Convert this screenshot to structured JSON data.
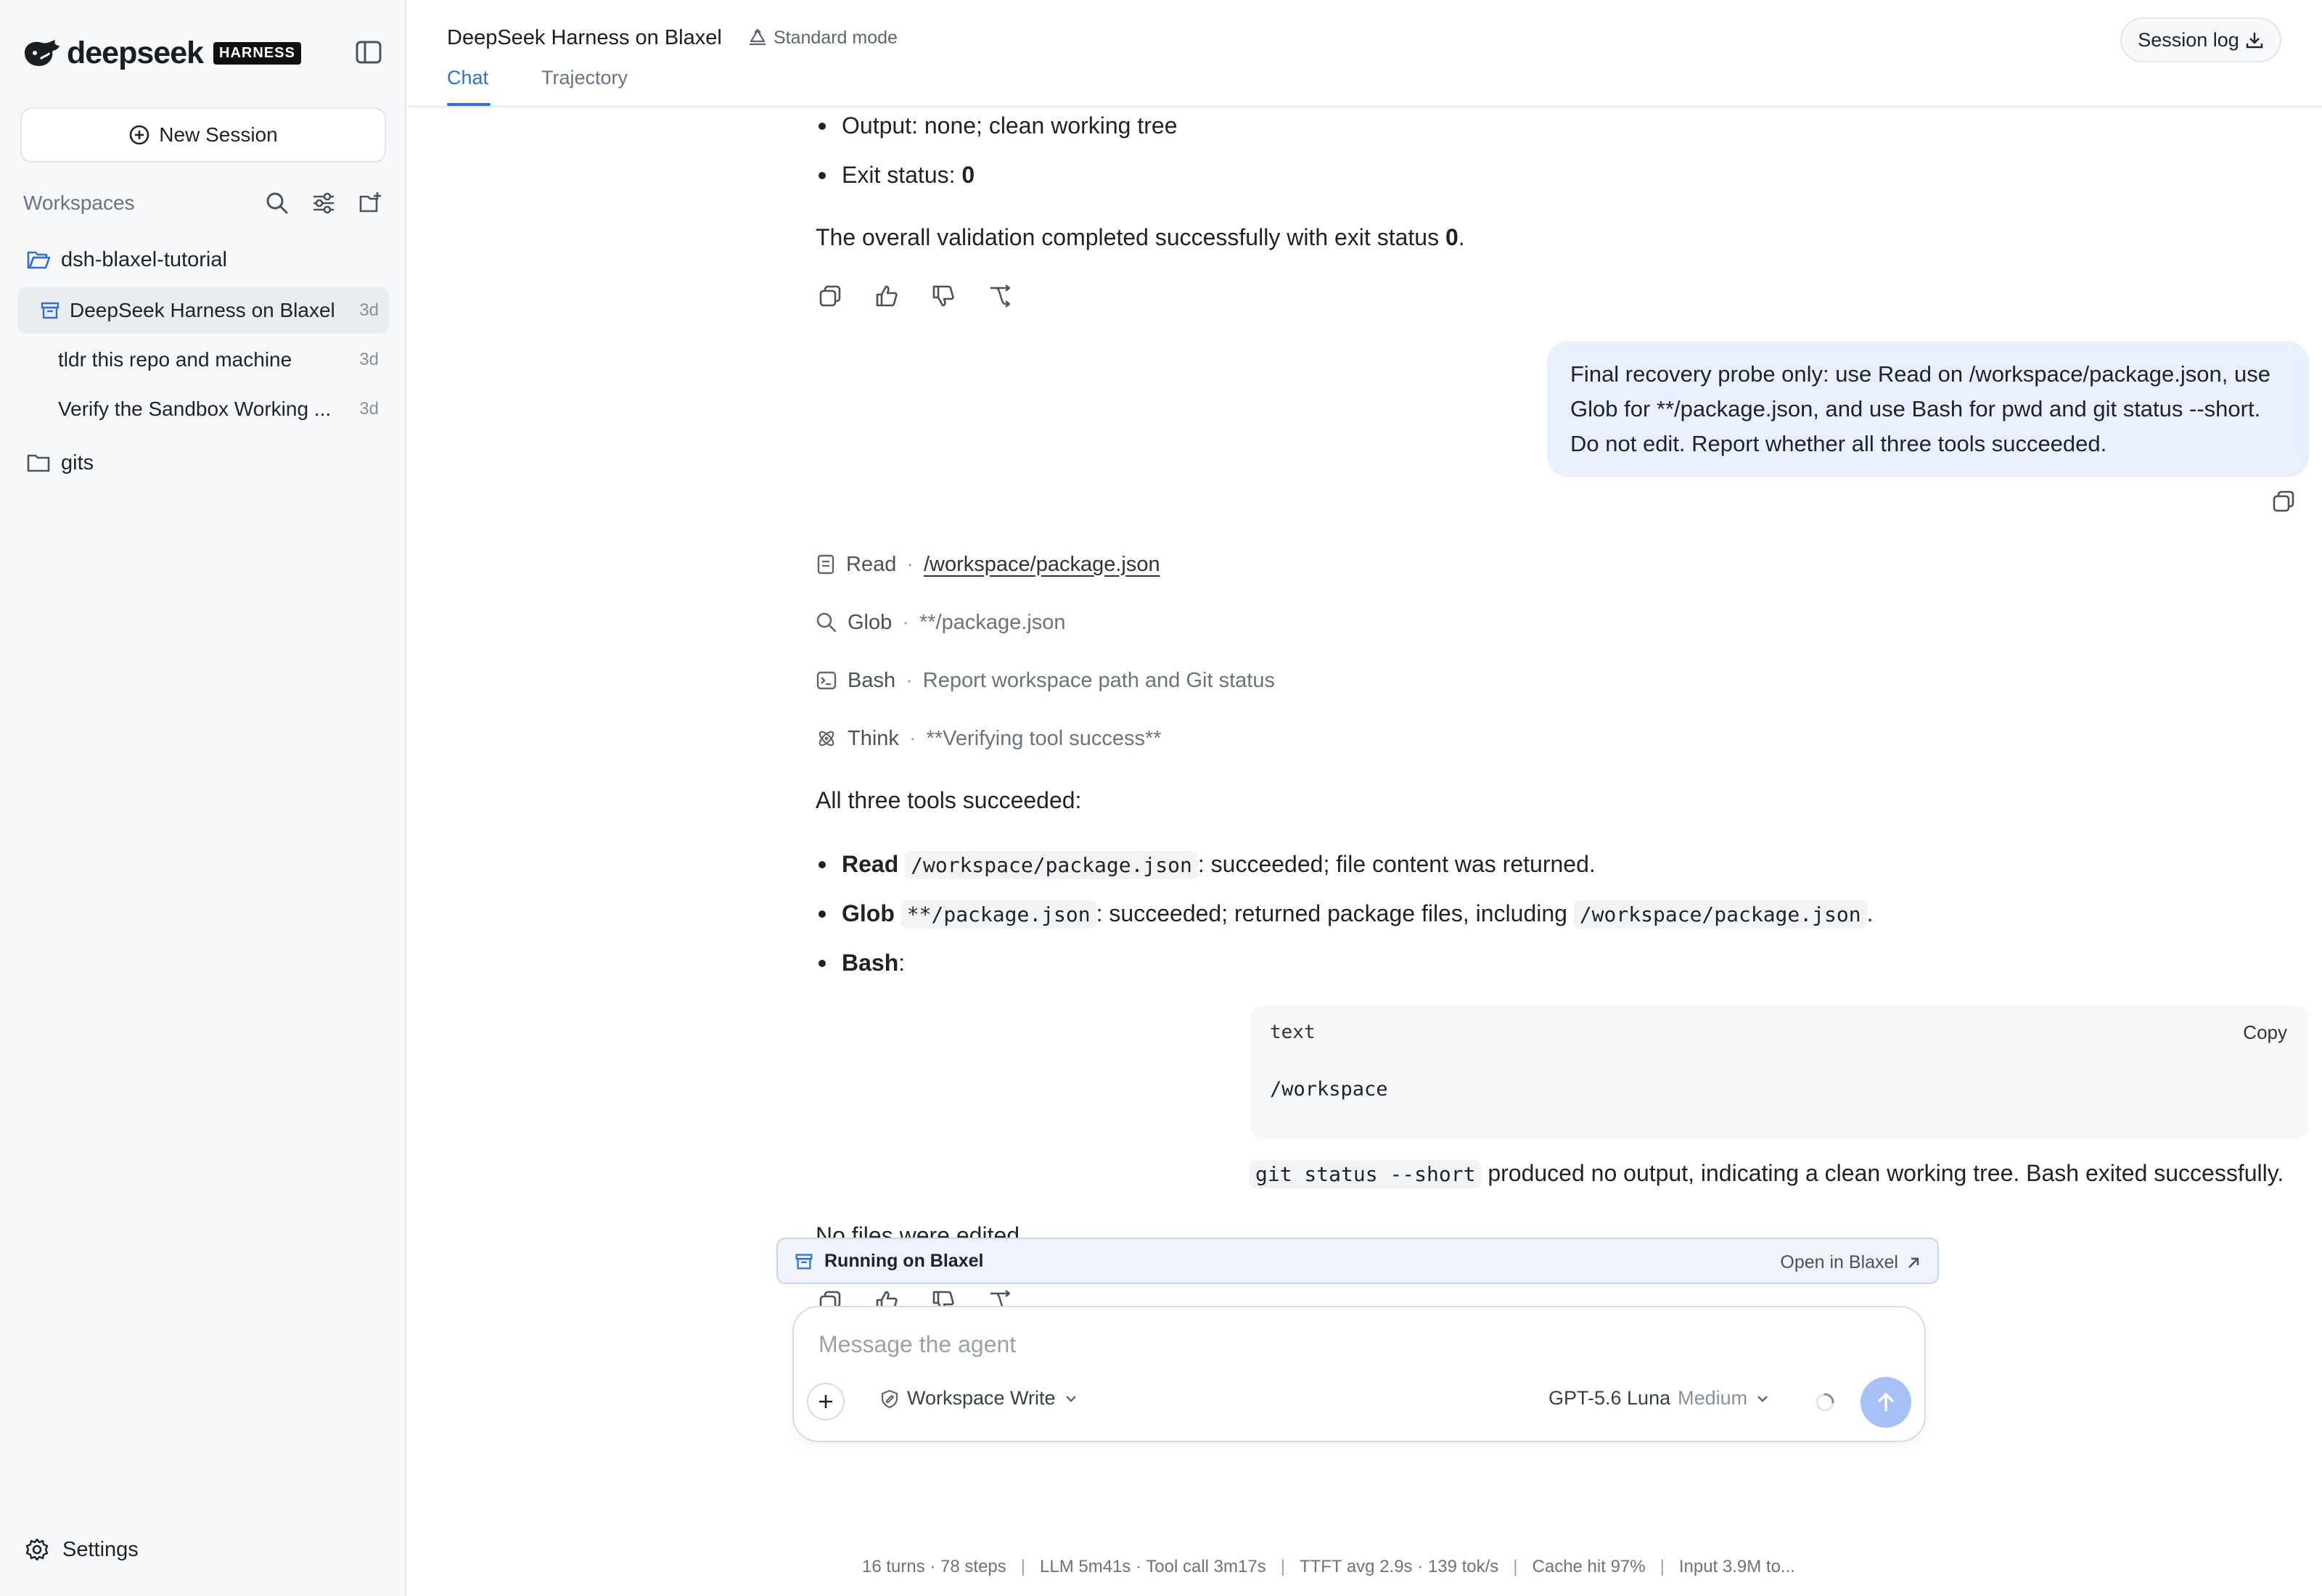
{
  "brand": {
    "name": "deepseek",
    "badge": "HARNESS"
  },
  "sidebar": {
    "new_session": "New Session",
    "workspaces_title": "Workspaces",
    "workspace_name": "dsh-blaxel-tutorial",
    "sessions": [
      {
        "label": "DeepSeek Harness on Blaxel",
        "age": "3d"
      },
      {
        "label": "tldr this repo and machine",
        "age": "3d"
      },
      {
        "label": "Verify the Sandbox Working ...",
        "age": "3d"
      }
    ],
    "folder2": "gits",
    "settings": "Settings"
  },
  "header": {
    "title": "DeepSeek Harness on Blaxel",
    "mode": "Standard mode",
    "tabs": [
      "Chat",
      "Trajectory"
    ],
    "session_log": "Session log"
  },
  "chat": {
    "prev": {
      "bullet1": "Output: none; clean working tree",
      "bullet2_label": "Exit status: ",
      "bullet2_value": "0",
      "summary": "The overall validation completed successfully with exit status ",
      "summary_value": "0",
      "summary_end": "."
    },
    "user_message": "Final recovery probe only: use Read on /workspace/package.json, use Glob for **/package.json, and use Bash for pwd and git status --short. Do not edit. Report whether all three tools succeeded.",
    "tools": [
      {
        "name": "Read",
        "detail": "/workspace/package.json",
        "icon": "file-icon"
      },
      {
        "name": "Glob",
        "detail": "**/package.json",
        "icon": "search-icon"
      },
      {
        "name": "Bash",
        "detail": "Report workspace path and Git status",
        "icon": "terminal-icon"
      },
      {
        "name": "Think",
        "detail": "**Verifying tool success**",
        "icon": "atom-icon"
      }
    ],
    "answer": {
      "intro": "All three tools succeeded:",
      "read_label": "Read",
      "read_code": "/workspace/package.json",
      "read_text": ": succeeded; file content was returned.",
      "glob_label": "Glob",
      "glob_code": "**/package.json",
      "glob_text": ": succeeded; returned package files, including ",
      "glob_code2": "/workspace/package.json",
      "glob_end": ".",
      "bash_label": "Bash",
      "bash_colon": ":",
      "code_lang": "text",
      "code_copy": "Copy",
      "code_body": "/workspace",
      "git_code": "git status --short",
      "git_text": " produced no output, indicating a clean working tree. Bash exited successfully.",
      "closing": "No files were edited."
    }
  },
  "runbar": {
    "label": "Running on Blaxel",
    "link": "Open in Blaxel"
  },
  "composer": {
    "placeholder": "Message the agent",
    "permission": "Workspace Write",
    "model": "GPT-5.6 Luna",
    "effort": "Medium"
  },
  "stats": [
    "16 turns · 78 steps",
    "LLM 5m41s · Tool call 3m17s",
    "TTFT avg 2.9s · 139 tok/s",
    "Cache hit 97%",
    "Input 3.9M to..."
  ],
  "colors": {
    "accent": "#2f6fd6",
    "user_bubble": "#e8efff",
    "send": "#a7c0f5"
  }
}
